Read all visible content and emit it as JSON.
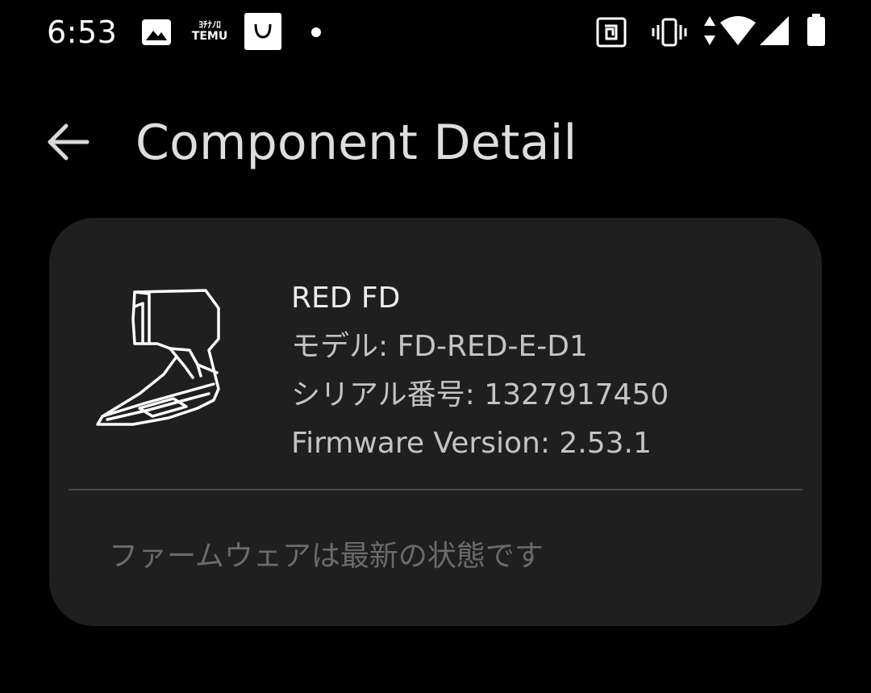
{
  "status_bar": {
    "time": "6:53",
    "notification_icons": [
      "gallery-icon",
      "temu-icon",
      "shopping-bag-icon",
      "dot-icon"
    ],
    "temu_text_line1": "ﾖﾁﾅﾉﾛ",
    "temu_text_line2": "TEMU",
    "system_icons": [
      "nfc-icon",
      "vibrate-icon",
      "data-arrows-icon",
      "wifi-icon",
      "signal-icon",
      "battery-icon"
    ]
  },
  "app_bar": {
    "back_icon": "arrow-left-icon",
    "title": "Component Detail"
  },
  "component": {
    "image_icon": "front-derailleur-icon",
    "name": "RED FD",
    "model": "モデル: FD-RED-E-D1",
    "serial": "シリアル番号: 1327917450",
    "firmware": "Firmware Version: 2.53.1",
    "firmware_status": "ファームウェアは最新の状態です"
  },
  "colors": {
    "background": "#000000",
    "card": "#1f1f20",
    "title": "#dedede",
    "text_primary": "#ececec",
    "text_secondary": "#c4c4c4",
    "text_disabled": "#6b6b6b",
    "divider": "#4a4a4a"
  }
}
